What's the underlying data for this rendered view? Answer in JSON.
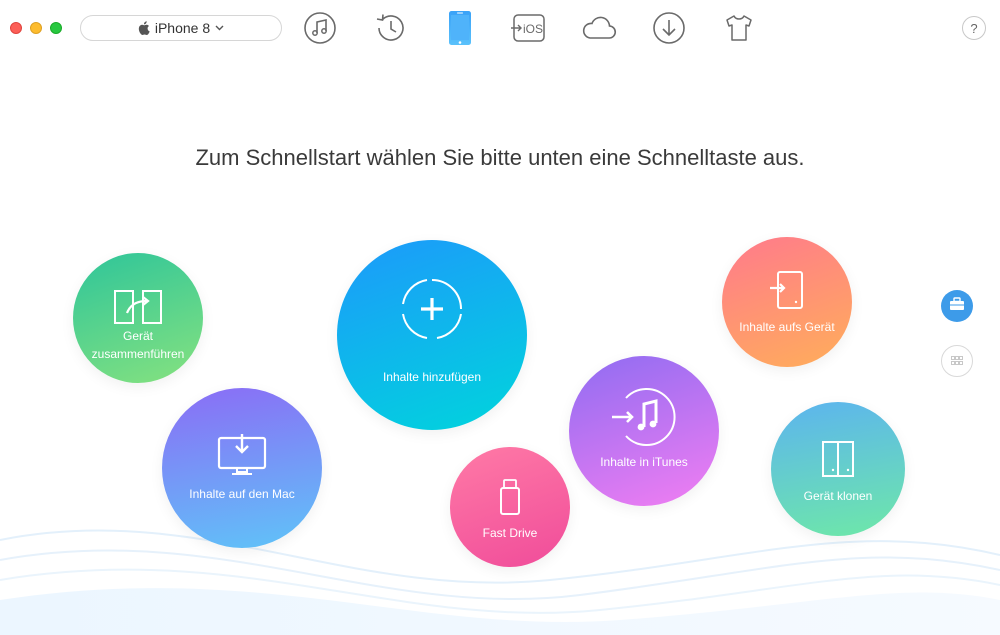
{
  "window": {
    "title": ""
  },
  "device": {
    "name": "iPhone 8"
  },
  "toolbar": {
    "items": [
      {
        "name": "music-icon"
      },
      {
        "name": "history-icon"
      },
      {
        "name": "device-icon",
        "active": true
      },
      {
        "name": "ios-transfer-icon",
        "label": "iOS"
      },
      {
        "name": "cloud-icon"
      },
      {
        "name": "download-icon"
      },
      {
        "name": "shirt-icon"
      }
    ],
    "help_label": "?"
  },
  "main": {
    "headline": "Zum Schnellstart wählen Sie bitte unten eine Schnelltaste aus."
  },
  "shortcuts": {
    "merge": {
      "label_line1": "Gerät",
      "label_line2": "zusammenführen",
      "colors": [
        "#2ec59a",
        "#86e27f"
      ]
    },
    "to_mac": {
      "label": "Inhalte auf den Mac",
      "colors": [
        "#8b6cf6",
        "#5fc4f8"
      ]
    },
    "add": {
      "label": "Inhalte hinzufügen",
      "colors": [
        "#1d99fb",
        "#00d5dc"
      ]
    },
    "fast_drive": {
      "label": "Fast Drive",
      "colors": [
        "#ff7aa6",
        "#f04c9a"
      ]
    },
    "to_itunes": {
      "label": "Inhalte in iTunes",
      "colors": [
        "#8f6cf2",
        "#f27ef2"
      ]
    },
    "to_device": {
      "label": "Inhalte aufs Gerät",
      "colors": [
        "#ff7a8c",
        "#ffae5a"
      ]
    },
    "clone": {
      "label": "Gerät klonen",
      "colors": [
        "#5cb4ef",
        "#6ee8a8"
      ]
    }
  },
  "side": {
    "toolbox": "toolbox-icon",
    "apps": "apps-grid-icon"
  },
  "colors": {
    "accent": "#1d99fb"
  }
}
